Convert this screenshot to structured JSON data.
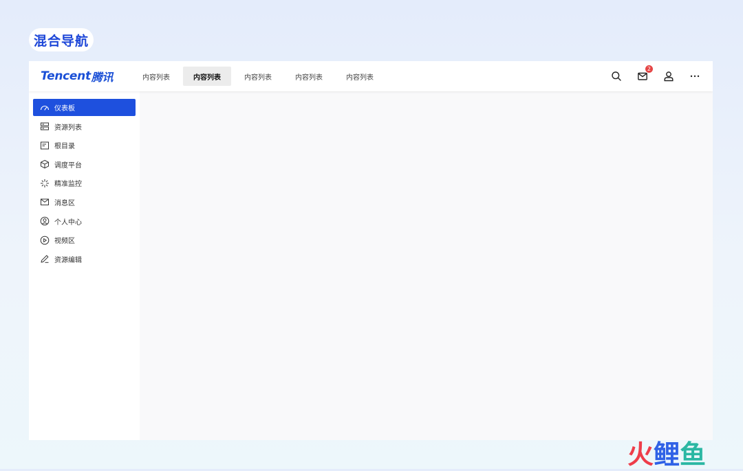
{
  "page_label": "混合导航",
  "logo": {
    "en": "Tencent",
    "cn": "腾讯"
  },
  "nav": {
    "items": [
      {
        "label": "内容列表",
        "active": false
      },
      {
        "label": "内容列表",
        "active": true
      },
      {
        "label": "内容列表",
        "active": false
      },
      {
        "label": "内容列表",
        "active": false
      },
      {
        "label": "内容列表",
        "active": false
      }
    ]
  },
  "header_actions": {
    "search_icon": "search-icon",
    "mail_icon": "mail-icon",
    "mail_badge": "2",
    "user_icon": "user-icon",
    "more_icon": "more-icon"
  },
  "sidebar": {
    "items": [
      {
        "label": "仪表板",
        "icon": "dashboard-icon",
        "active": true
      },
      {
        "label": "资源列表",
        "icon": "server-icon",
        "active": false
      },
      {
        "label": "根目录",
        "icon": "folder-icon",
        "active": false
      },
      {
        "label": "调度平台",
        "icon": "cube-icon",
        "active": false
      },
      {
        "label": "精准监控",
        "icon": "monitor-icon",
        "active": false
      },
      {
        "label": "消息区",
        "icon": "mail-icon",
        "active": false
      },
      {
        "label": "个人中心",
        "icon": "user-circle-icon",
        "active": false
      },
      {
        "label": "视频区",
        "icon": "play-circle-icon",
        "active": false
      },
      {
        "label": "资源编辑",
        "icon": "edit-icon",
        "active": false
      }
    ]
  },
  "watermark": {
    "part1": "火",
    "part2": "鲤",
    "part3": "鱼"
  },
  "colors": {
    "accent": "#1e50de",
    "badge": "#e54545",
    "brand": "#1a4fd6"
  }
}
